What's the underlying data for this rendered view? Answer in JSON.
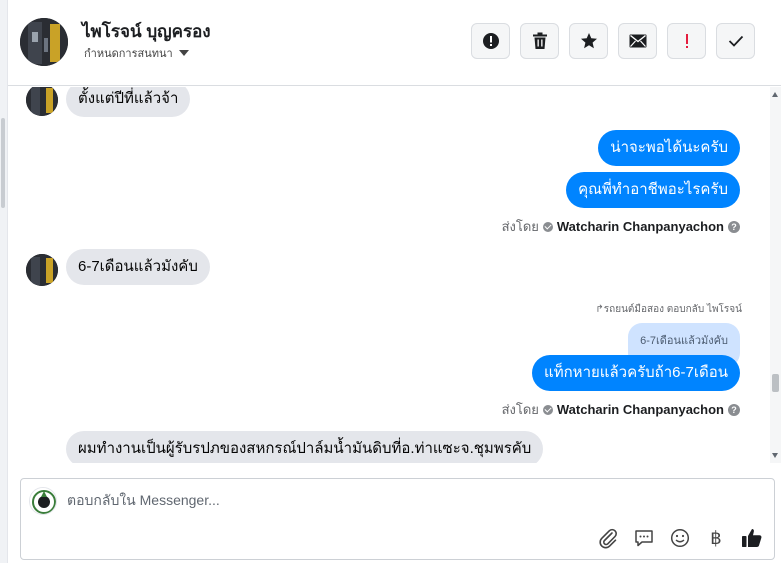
{
  "header": {
    "name": "ไพโรจน์ บุญครอง",
    "assign_label": "กำหนดการสนทนา",
    "actions": [
      {
        "name": "mark-spam-button",
        "icon": "exclamation-circle-icon"
      },
      {
        "name": "delete-button",
        "icon": "trash-icon"
      },
      {
        "name": "star-button",
        "icon": "star-icon"
      },
      {
        "name": "mark-unread-button",
        "icon": "envelope-icon"
      },
      {
        "name": "follow-up-button",
        "icon": "exclamation-icon"
      },
      {
        "name": "mark-done-button",
        "icon": "checkmark-icon"
      }
    ]
  },
  "messages": {
    "m1": "ตั้งแต่ปีที่แล้วจ้า",
    "m2": "น่าจะพอได้นะครับ",
    "m3": "คุณพี่ทำอาชีพอะไรครับ",
    "m4": "6-7เดือนแล้วมังคับ",
    "reply_note": "↱รถยนต์มือสอง ตอบกลับ ไพโรจน์",
    "quoted": "6-7เดือนแล้วมังคับ",
    "m5": "แท็กหายแล้วครับถ้า6-7เดือน",
    "m6": "ผมทำงานเป็นผู้รับรปภของสหกรณ์ปาล์มน้ำมันดิบที่อ.ท่าแซะจ.ชุมพรคับ"
  },
  "sent_by": {
    "prefix": "ส่งโดย",
    "agent": "Watcharin Chanpanyachon",
    "help": "?"
  },
  "composer": {
    "placeholder": "ตอบกลับใน Messenger...",
    "tools": [
      "attach-icon",
      "saved-reply-icon",
      "emoji-icon",
      "baht-icon",
      "thumbs-up-icon"
    ],
    "baht_symbol": "฿"
  },
  "colors": {
    "outgoing": "#0084ff",
    "incoming": "#e4e6eb",
    "quoted": "#cfe3ff"
  }
}
